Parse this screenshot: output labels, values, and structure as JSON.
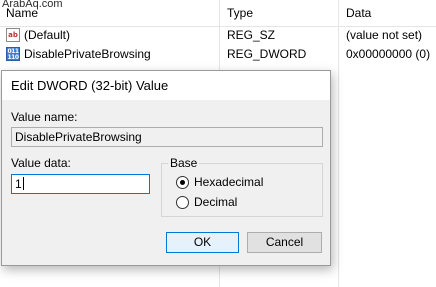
{
  "watermark": "ArabAq.com",
  "columns": {
    "name": "Name",
    "type": "Type",
    "data": "Data"
  },
  "rows": [
    {
      "icon": "string-value-icon",
      "name": "(Default)",
      "type": "REG_SZ",
      "data": "(value not set)"
    },
    {
      "icon": "dword-value-icon",
      "name": "DisablePrivateBrowsing",
      "type": "REG_DWORD",
      "data": "0x00000000 (0)"
    }
  ],
  "icons": {
    "string_glyph": "ab",
    "binary_glyph": "011\n110"
  },
  "dialog": {
    "title": "Edit DWORD (32-bit) Value",
    "value_name_label": "Value name:",
    "value_name": "DisablePrivateBrowsing",
    "value_data_label": "Value data:",
    "value_data": "1",
    "base_label": "Base",
    "base_options": [
      {
        "label": "Hexadecimal",
        "selected": true
      },
      {
        "label": "Decimal",
        "selected": false
      }
    ],
    "ok_label": "OK",
    "cancel_label": "Cancel"
  },
  "colors": {
    "accent": "#0078d7",
    "dialog_bg": "#f0f0f0",
    "button_bg": "#e1e1e1"
  }
}
